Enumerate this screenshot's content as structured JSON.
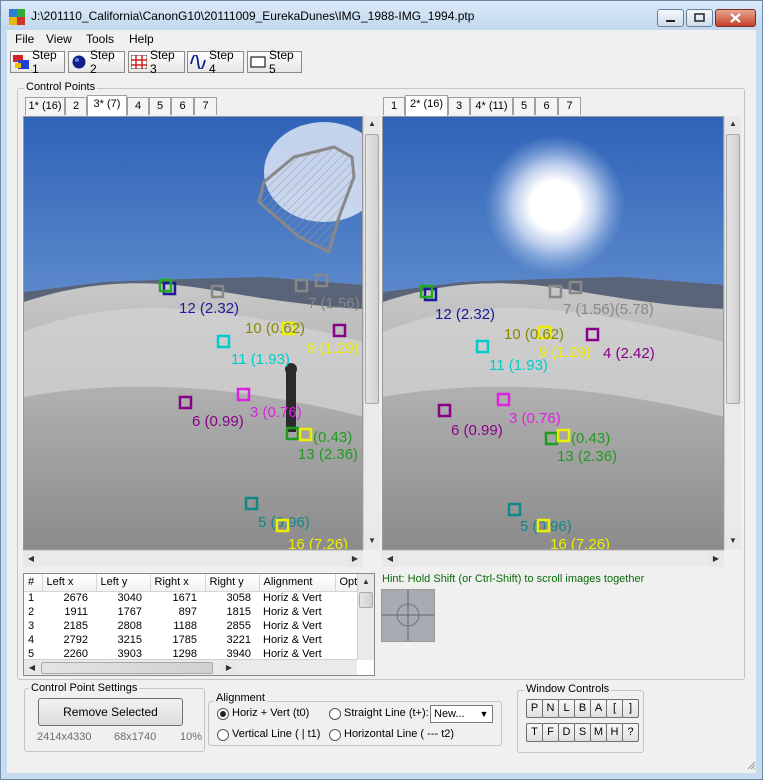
{
  "window": {
    "title": "J:\\201110_California\\CanonG10\\20111009_EurekaDunes\\IMG_1988-IMG_1994.ptp"
  },
  "menu": [
    "File",
    "View",
    "Tools",
    "Help"
  ],
  "toolbar": [
    "Step 1",
    "Step 2",
    "Step 3",
    "Step 4",
    "Step 5"
  ],
  "control_points": {
    "group_label": "Control Points",
    "left_tabs": [
      "1* (16)",
      "2",
      "3* (7)",
      "4",
      "5",
      "6",
      "7"
    ],
    "left_active": 2,
    "right_tabs": [
      "1",
      "2* (16)",
      "3",
      "4* (11)",
      "5",
      "6",
      "7"
    ],
    "right_active": 1,
    "left_points": [
      {
        "label": "12 (2.32)",
        "color": "#1a1a9a"
      },
      {
        "label": "9",
        "color": "#22aa22"
      },
      {
        "label": "7 (1.56)",
        "color": "#888888"
      },
      {
        "label": "10 (0.62)",
        "color": "#888800"
      },
      {
        "label": "11 (1.93)",
        "color": "#00cccc"
      },
      {
        "label": "9 (1.29)",
        "color": "#eeee00"
      },
      {
        "label": "6 (0.99)",
        "color": "#880088"
      },
      {
        "label": "3 (0.76)",
        "color": "#dd22dd"
      },
      {
        "label": "(0.43)",
        "color": "#229922"
      },
      {
        "label": "13 (2.36)",
        "color": "#229922"
      },
      {
        "label": "5 (0.96)",
        "color": "#118888"
      },
      {
        "label": "16 (7.26)",
        "color": "#eeee00"
      }
    ],
    "right_points": [
      {
        "label": "12 (2.32)",
        "color": "#1a1a9a"
      },
      {
        "label": "9",
        "color": "#22aa22"
      },
      {
        "label": "7 (1.56)(5.78)",
        "color": "#888888"
      },
      {
        "label": "10 (0.62)",
        "color": "#888800"
      },
      {
        "label": "11 (1.93)",
        "color": "#00cccc"
      },
      {
        "label": "9 (1.29)",
        "color": "#eeee00"
      },
      {
        "label": "4 (2.42)",
        "color": "#880088"
      },
      {
        "label": "6 (0.99)",
        "color": "#880088"
      },
      {
        "label": "3 (0.76)",
        "color": "#dd22dd"
      },
      {
        "label": "(0.43)",
        "color": "#229922"
      },
      {
        "label": "13 (2.36)",
        "color": "#229922"
      },
      {
        "label": "5 (0.96)",
        "color": "#118888"
      },
      {
        "label": "16 (7.26)",
        "color": "#eeee00"
      }
    ],
    "hint": "Hint: Hold Shift (or Ctrl-Shift) to scroll images together"
  },
  "table": {
    "headers": [
      "#",
      "Left x",
      "Left y",
      "Right x",
      "Right y",
      "Alignment",
      "Opti"
    ],
    "rows": [
      [
        "1",
        "2676",
        "3040",
        "1671",
        "3058",
        "Horiz & Vert"
      ],
      [
        "2",
        "1911",
        "1767",
        "897",
        "1815",
        "Horiz & Vert"
      ],
      [
        "3",
        "2185",
        "2808",
        "1188",
        "2855",
        "Horiz & Vert"
      ],
      [
        "4",
        "2792",
        "3215",
        "1785",
        "3221",
        "Horiz & Vert"
      ],
      [
        "5",
        "2260",
        "3903",
        "1298",
        "3940",
        "Horiz & Vert"
      ]
    ]
  },
  "settings": {
    "group_label": "Control Point Settings",
    "remove_button": "Remove Selected",
    "size_left": "2414x4330",
    "size_right": "68x1740",
    "percent": "10%"
  },
  "alignment": {
    "group_label": "Alignment",
    "options": [
      "Horiz + Vert (t0)",
      "Straight Line (t+):",
      "Vertical Line ( | t1)",
      "Horizontal Line ( --- t2)"
    ],
    "selected": 0,
    "dropdown_value": "New..."
  },
  "window_controls": {
    "group_label": "Window Controls",
    "row1": [
      "P",
      "N",
      "L",
      "B",
      "A",
      "[",
      "]"
    ],
    "row2": [
      "T",
      "F",
      "D",
      "S",
      "M",
      "H",
      "?"
    ]
  }
}
